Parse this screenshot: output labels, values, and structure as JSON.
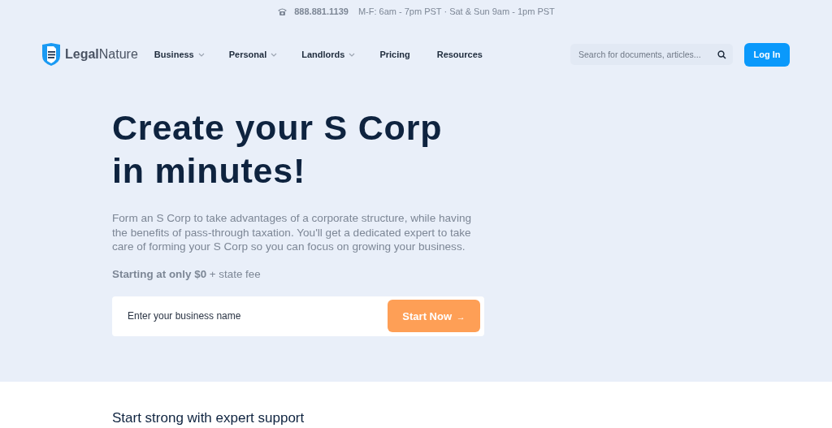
{
  "contact_bar": {
    "phone": "888.881.1139",
    "hours": "M-F: 6am - 7pm PST · Sat & Sun 9am - 1pm PST"
  },
  "header": {
    "logo": "**Legal**Nature",
    "nav": [
      {
        "label": "Business",
        "has_menu": true
      },
      {
        "label": "Personal",
        "has_menu": true
      },
      {
        "label": "Landlords",
        "has_menu": true
      },
      {
        "label": "Pricing",
        "has_menu": false
      },
      {
        "label": "Resources",
        "has_menu": false
      }
    ],
    "search": {
      "placeholder": "Search for documents, articles..."
    },
    "login": "Log In"
  },
  "hero": {
    "heading_lines": [
      "Create your S Corp",
      "in minutes!"
    ],
    "description": "Form an S Corp to take advantages of a corporate structure, while having the benefits of pass-through taxation. You'll get a dedicated expert to take care of forming your S Corp so you can focus on growing your business.",
    "price": "**Starting at only $0** + state fee",
    "form": {
      "placeholder": "Enter your business name",
      "button": "Start Now",
      "button_arrow": "→"
    }
  },
  "section": {
    "heading": "Start strong with expert support"
  }
}
